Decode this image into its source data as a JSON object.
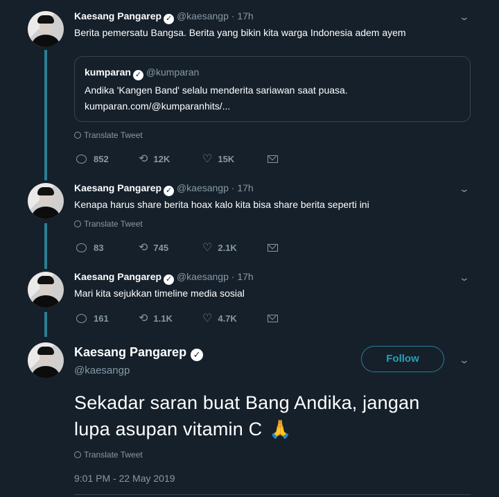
{
  "thread": [
    {
      "name": "Kaesang Pangarep",
      "handle": "@kaesangp",
      "separator": "·",
      "time": "17h",
      "text": "Berita pemersatu Bangsa. Berita yang bikin kita warga Indonesia adem ayem",
      "quote": {
        "name": "kumparan",
        "handle": "@kumparan",
        "line1": "Andika 'Kangen Band' selalu menderita sariawan saat puasa.",
        "line2": "kumparan.com/@kumparanhits/..."
      },
      "translate": "Translate Tweet",
      "replies": "852",
      "retweets": "12K",
      "likes": "15K"
    },
    {
      "name": "Kaesang Pangarep",
      "handle": "@kaesangp",
      "separator": "·",
      "time": "17h",
      "text": "Kenapa harus share berita hoax kalo kita bisa share berita seperti ini",
      "translate": "Translate Tweet",
      "replies": "83",
      "retweets": "745",
      "likes": "2.1K"
    },
    {
      "name": "Kaesang Pangarep",
      "handle": "@kaesangp",
      "separator": "·",
      "time": "17h",
      "text": "Mari kita sejukkan timeline media sosial",
      "replies": "161",
      "retweets": "1.1K",
      "likes": "4.7K"
    }
  ],
  "main": {
    "name": "Kaesang Pangarep",
    "handle": "@kaesangp",
    "follow_label": "Follow",
    "line1": "Sekadar saran buat Bang Andika, jangan",
    "line2": "lupa asupan vitamin C",
    "emoji_icon": "folded-hands-icon",
    "translate": "Translate Tweet",
    "timestamp": "9:01 PM - 22 May 2019"
  },
  "colors": {
    "background": "#15202b",
    "secondary_text": "#8899a6",
    "accent": "#2a9fb5",
    "thread_line": "#2a7f93"
  }
}
